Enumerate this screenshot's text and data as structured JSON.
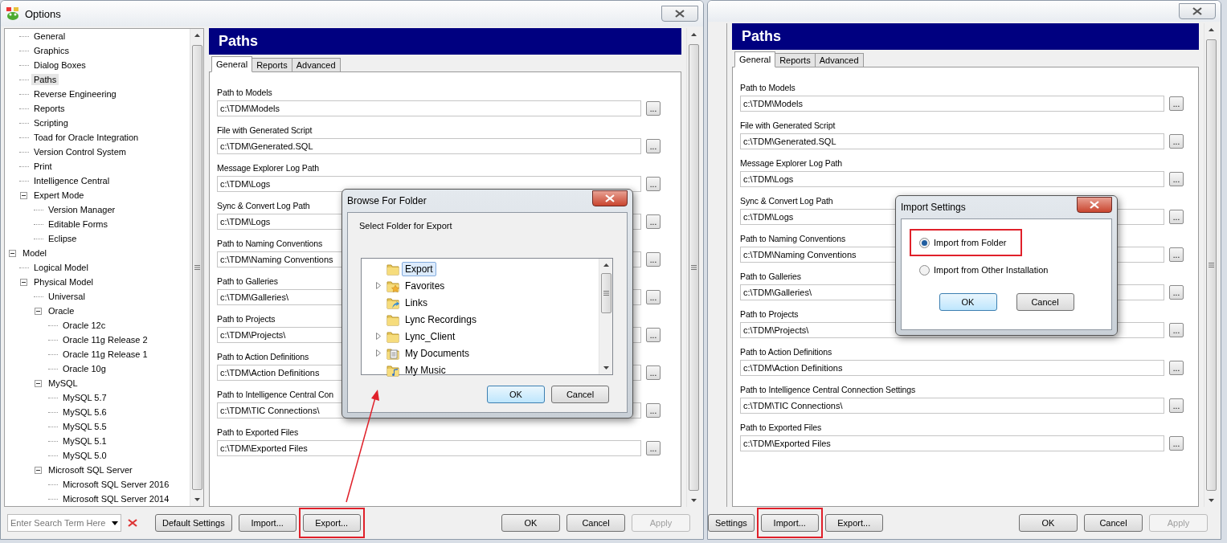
{
  "windows": [
    {
      "title": "Options",
      "browse_label": "...",
      "tree": [
        {
          "children": [
            {
              "label": "General",
              "selected": false
            },
            {
              "label": "Graphics",
              "selected": false
            },
            {
              "label": "Dialog Boxes",
              "selected": false
            },
            {
              "label": "Paths",
              "selected": true
            },
            {
              "label": "Reverse Engineering",
              "selected": false
            },
            {
              "label": "Reports",
              "selected": false
            },
            {
              "label": "Scripting",
              "selected": false
            },
            {
              "label": "Toad for Oracle Integration",
              "selected": false
            },
            {
              "label": "Version Control System",
              "selected": false
            },
            {
              "label": "Print",
              "selected": false
            },
            {
              "label": "Intelligence Central",
              "selected": false
            },
            {
              "label": "Expert Mode",
              "selected": false,
              "expanded": true,
              "children": [
                {
                  "label": "Version Manager",
                  "selected": false
                },
                {
                  "label": "Editable Forms",
                  "selected": false
                },
                {
                  "label": "Eclipse",
                  "selected": false
                }
              ]
            }
          ]
        },
        {
          "label": "Model",
          "selected": false,
          "expanded": true,
          "children": [
            {
              "label": "Logical Model",
              "selected": false
            },
            {
              "label": "Physical Model",
              "selected": false,
              "expanded": true,
              "children": [
                {
                  "label": "Universal",
                  "selected": false
                },
                {
                  "label": "Oracle",
                  "selected": false,
                  "expanded": true,
                  "children": [
                    {
                      "label": "Oracle 12c",
                      "selected": false
                    },
                    {
                      "label": "Oracle 11g Release 2",
                      "selected": false
                    },
                    {
                      "label": "Oracle 11g Release 1",
                      "selected": false
                    },
                    {
                      "label": "Oracle 10g",
                      "selected": false
                    }
                  ]
                },
                {
                  "label": "MySQL",
                  "selected": false,
                  "expanded": true,
                  "children": [
                    {
                      "label": "MySQL 5.7",
                      "selected": false
                    },
                    {
                      "label": "MySQL 5.6",
                      "selected": false
                    },
                    {
                      "label": "MySQL 5.5",
                      "selected": false
                    },
                    {
                      "label": "MySQL 5.1",
                      "selected": false
                    },
                    {
                      "label": "MySQL 5.0",
                      "selected": false
                    }
                  ]
                },
                {
                  "label": "Microsoft SQL Server",
                  "selected": false,
                  "expanded": true,
                  "children": [
                    {
                      "label": "Microsoft SQL Server 2016",
                      "selected": false
                    },
                    {
                      "label": "Microsoft SQL Server 2014",
                      "selected": false
                    }
                  ]
                }
              ]
            }
          ]
        }
      ],
      "search": {
        "placeholder": "Enter Search Term Here"
      },
      "header": "Paths",
      "tabs": [
        {
          "label": "General",
          "selected": true
        },
        {
          "label": "Reports",
          "selected": false
        },
        {
          "label": "Advanced",
          "selected": false
        }
      ],
      "fields": [
        {
          "label": "Path to Models",
          "value": "c:\\TDM\\Models"
        },
        {
          "label": "File with Generated Script",
          "value": "c:\\TDM\\Generated.SQL"
        },
        {
          "label": "Message Explorer Log Path",
          "value": "c:\\TDM\\Logs"
        },
        {
          "label": "Sync & Convert Log Path",
          "value": "c:\\TDM\\Logs"
        },
        {
          "label": "Path to Naming Conventions",
          "value": "c:\\TDM\\Naming Conventions"
        },
        {
          "label": "Path to Galleries",
          "value": "c:\\TDM\\Galleries\\"
        },
        {
          "label": "Path to Projects",
          "value": "c:\\TDM\\Projects\\"
        },
        {
          "label": "Path to Action Definitions",
          "value": "c:\\TDM\\Action Definitions"
        },
        {
          "label": "Path to Intelligence Central Con",
          "value": "c:\\TDM\\TIC Connections\\"
        },
        {
          "label": "Path to Exported Files",
          "value": "c:\\TDM\\Exported Files"
        }
      ],
      "buttons_left": [
        {
          "label": "Default Settings",
          "highlighted": false,
          "disabled": false
        },
        {
          "label": "Import...",
          "highlighted": false,
          "disabled": false
        },
        {
          "label": "Export...",
          "highlighted": true,
          "disabled": false
        }
      ],
      "buttons_right": [
        {
          "label": "OK",
          "highlighted": false,
          "disabled": false
        },
        {
          "label": "Cancel",
          "highlighted": false,
          "disabled": false
        },
        {
          "label": "Apply",
          "highlighted": false,
          "disabled": true
        }
      ],
      "dialog": {
        "kind": "folder_browser",
        "title": "Browse For Folder",
        "prompt": "Select Folder for Export",
        "folders": [
          {
            "name": "Export",
            "kind": "folder",
            "expandable": false,
            "selected": true
          },
          {
            "name": "Favorites",
            "kind": "favorites",
            "expandable": true,
            "selected": false
          },
          {
            "name": "Links",
            "kind": "links",
            "expandable": false,
            "selected": false
          },
          {
            "name": "Lync Recordings",
            "kind": "folder",
            "expandable": false,
            "selected": false
          },
          {
            "name": "Lync_Client",
            "kind": "folder",
            "expandable": true,
            "selected": false
          },
          {
            "name": "My Documents",
            "kind": "documents",
            "expandable": true,
            "selected": false
          },
          {
            "name": "My Music",
            "kind": "music",
            "expandable": false,
            "selected": false
          }
        ],
        "buttons": [
          {
            "label": "OK",
            "focused": true
          },
          {
            "label": "Cancel",
            "focused": false
          }
        ]
      }
    },
    {
      "header": "Paths",
      "browse_label": "...",
      "tabs": [
        {
          "label": "General",
          "selected": true
        },
        {
          "label": "Reports",
          "selected": false
        },
        {
          "label": "Advanced",
          "selected": false
        }
      ],
      "fields": [
        {
          "label": "Path to Models",
          "value": "c:\\TDM\\Models"
        },
        {
          "label": "File with Generated Script",
          "value": "c:\\TDM\\Generated.SQL"
        },
        {
          "label": "Message Explorer Log Path",
          "value": "c:\\TDM\\Logs"
        },
        {
          "label": "Sync & Convert Log Path",
          "value": "c:\\TDM\\Logs"
        },
        {
          "label": "Path to Naming Conventions",
          "value": "c:\\TDM\\Naming Conventions"
        },
        {
          "label": "Path to Galleries",
          "value": "c:\\TDM\\Galleries\\"
        },
        {
          "label": "Path to Projects",
          "value": "c:\\TDM\\Projects\\"
        },
        {
          "label": "Path to Action Definitions",
          "value": "c:\\TDM\\Action Definitions"
        },
        {
          "label": "Path to Intelligence Central Connection Settings",
          "value": "c:\\TDM\\TIC Connections\\"
        },
        {
          "label": "Path to Exported Files",
          "value": "c:\\TDM\\Exported Files"
        }
      ],
      "buttons_left": [
        {
          "label": "Settings",
          "highlighted": false,
          "disabled": false
        },
        {
          "label": "Import...",
          "highlighted": true,
          "disabled": false
        },
        {
          "label": "Export...",
          "highlighted": false,
          "disabled": false
        }
      ],
      "buttons_right": [
        {
          "label": "OK",
          "highlighted": false,
          "disabled": false
        },
        {
          "label": "Cancel",
          "highlighted": false,
          "disabled": false
        },
        {
          "label": "Apply",
          "highlighted": false,
          "disabled": true
        }
      ],
      "dialog": {
        "kind": "import_settings",
        "title": "Import Settings",
        "options": [
          {
            "label": "Import from Folder",
            "selected": true,
            "highlighted": true
          },
          {
            "label": "Import from Other Installation",
            "selected": false,
            "highlighted": false
          }
        ],
        "buttons": [
          {
            "label": "OK",
            "focused": true
          },
          {
            "label": "Cancel",
            "focused": false
          }
        ]
      }
    }
  ]
}
